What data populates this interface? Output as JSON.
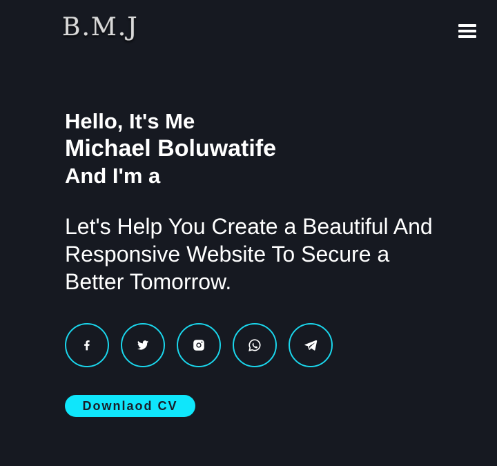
{
  "header": {
    "logo": "B.M.J",
    "menu_icon": "hamburger-menu-icon"
  },
  "hero": {
    "greeting": "Hello, It's Me",
    "name": "Michael Boluwatife",
    "role_prefix": "And I'm a",
    "tagline": "Let's Help You Create a Beautiful And Responsive Website To Secure a Better Tomorrow."
  },
  "socials": [
    {
      "icon": "facebook-icon"
    },
    {
      "icon": "twitter-icon"
    },
    {
      "icon": "instagram-icon"
    },
    {
      "icon": "whatsapp-icon"
    },
    {
      "icon": "telegram-icon"
    }
  ],
  "cta": {
    "download_cv_label": "Downlaod CV"
  },
  "colors": {
    "background": "#161921",
    "accent": "#0fe6fb",
    "text": "#ffffff"
  }
}
